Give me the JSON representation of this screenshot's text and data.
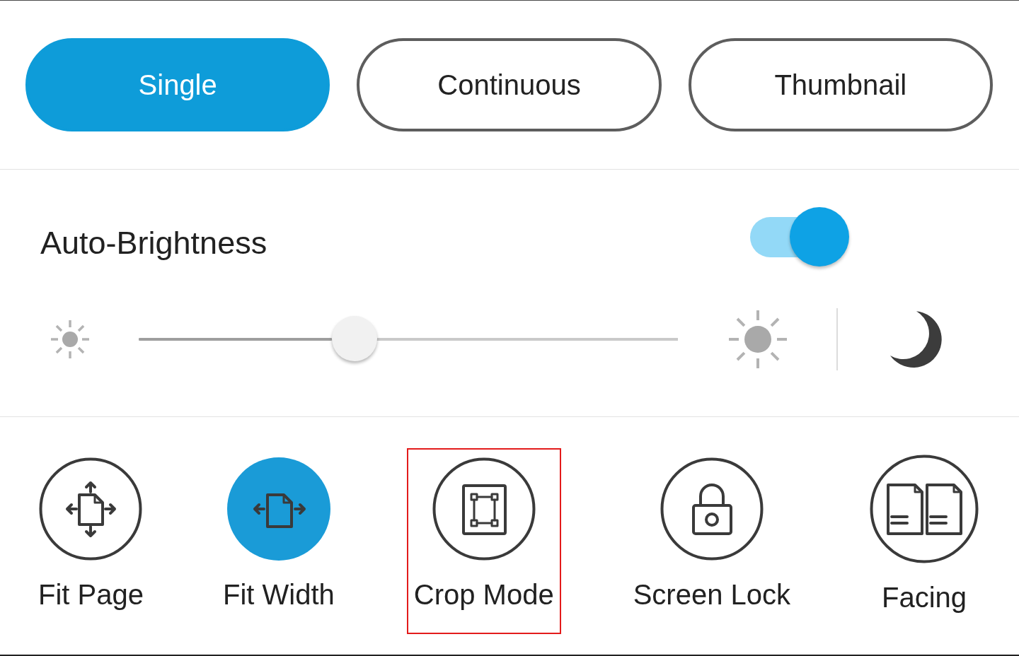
{
  "view_modes": [
    {
      "label": "Single",
      "selected": true
    },
    {
      "label": "Continuous",
      "selected": false
    },
    {
      "label": "Thumbnail",
      "selected": false
    }
  ],
  "auto_brightness": {
    "label": "Auto-Brightness",
    "on": true
  },
  "brightness": {
    "level": 0.4
  },
  "tools": [
    {
      "kind": "fit_page",
      "label": "Fit Page",
      "selected": false,
      "highlighted": false
    },
    {
      "kind": "fit_width",
      "label": "Fit Width",
      "selected": true,
      "highlighted": false
    },
    {
      "kind": "crop",
      "label": "Crop Mode",
      "selected": false,
      "highlighted": true
    },
    {
      "kind": "lock",
      "label": "Screen Lock",
      "selected": false,
      "highlighted": false
    },
    {
      "kind": "facing",
      "label": "Facing",
      "selected": false,
      "highlighted": false
    }
  ]
}
